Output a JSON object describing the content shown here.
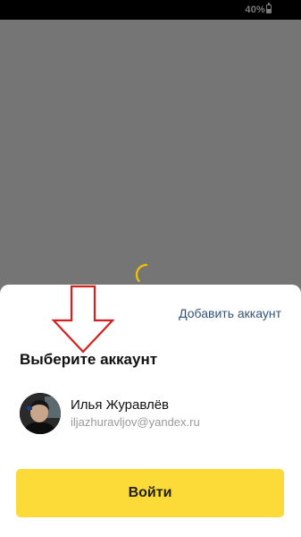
{
  "status_bar": {
    "battery_text": "40%",
    "battery_icon": "battery-icon",
    "battery_level_percent": 40
  },
  "colors": {
    "scrim": "#757575",
    "accent_yellow": "#fcda38",
    "link_blue": "#33527a",
    "annotation_red": "#d42020",
    "spinner": "#f2c200"
  },
  "loading": {
    "icon": "spinner-icon"
  },
  "account_sheet": {
    "add_account_label": "Добавить аккаунт",
    "title": "Выберите аккаунт",
    "accounts": [
      {
        "name": "Илья Журавлёв",
        "email": "iljazhuravljov@yandex.ru",
        "avatar": "avatar-photo"
      }
    ],
    "login_button_label": "Войти"
  },
  "annotation": {
    "icon": "red-down-arrow"
  }
}
